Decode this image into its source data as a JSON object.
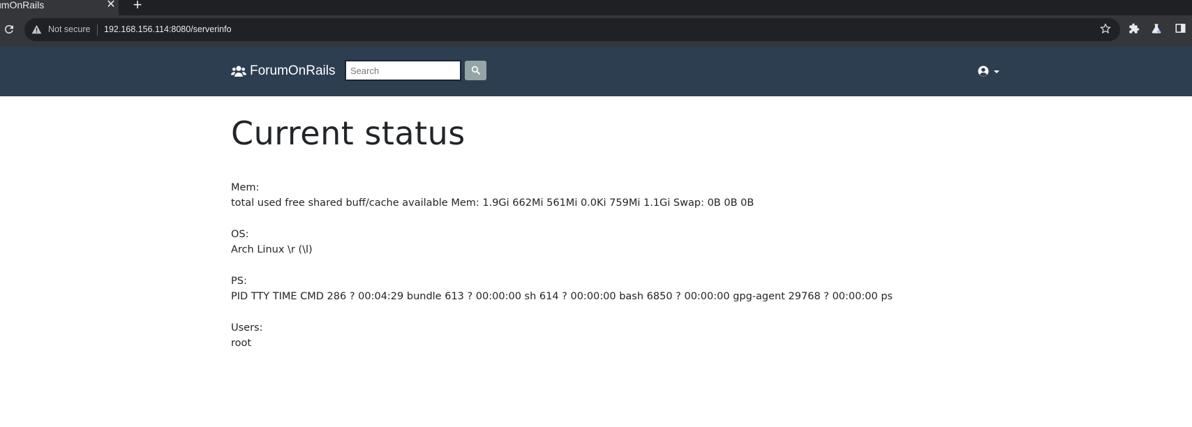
{
  "browser": {
    "tab_title": "umOnRails",
    "tab_close": "✕",
    "new_tab": "+",
    "security_label": "Not secure",
    "url": "192.168.156.114:8080/serverinfo"
  },
  "navbar": {
    "brand": "ForumOnRails",
    "search_placeholder": "Search",
    "background_color": "#2c3e50",
    "search_button_color": "#95a5a6"
  },
  "page": {
    "title": "Current status",
    "sections": [
      {
        "label": "Mem:",
        "value": "total used free shared buff/cache available Mem: 1.9Gi 662Mi 561Mi 0.0Ki 759Mi 1.1Gi Swap: 0B 0B 0B"
      },
      {
        "label": "OS:",
        "value": "Arch Linux \\r (\\l)"
      },
      {
        "label": "PS:",
        "value": "PID TTY TIME CMD 286 ? 00:04:29 bundle 613 ? 00:00:00 sh 614 ? 00:00:00 bash 6850 ? 00:00:00 gpg-agent 29768 ? 00:00:00 ps"
      },
      {
        "label": "Users:",
        "value": "root"
      }
    ]
  },
  "icons": {
    "reload": "reload-icon",
    "warning": "warning-icon",
    "star": "bookmark-star-icon",
    "extensions": "puzzle-icon",
    "labs": "flask-icon",
    "sidepanel": "side-panel-icon",
    "users": "users-icon",
    "search": "search-icon",
    "account": "user-circle-icon"
  }
}
